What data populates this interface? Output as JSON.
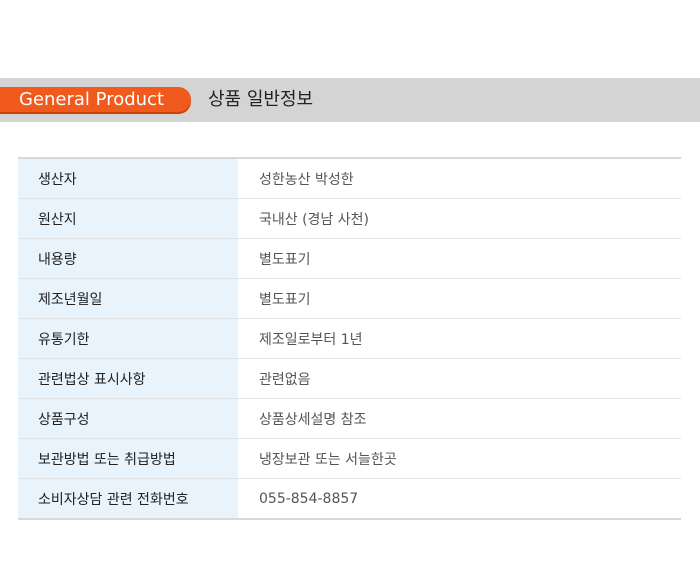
{
  "header": {
    "badge_label": "General Product",
    "title": "상품 일반정보",
    "accent_color": "#f05a1c",
    "bar_color": "#d4d4d4"
  },
  "table": {
    "label_bg_color": "#e8f3fc",
    "rows": [
      {
        "label": "생산자",
        "value": "성한농산 박성한"
      },
      {
        "label": "원산지",
        "value": "국내산 (경남 사천)"
      },
      {
        "label": "내용량",
        "value": "별도표기"
      },
      {
        "label": "제조년월일",
        "value": "별도표기"
      },
      {
        "label": "유통기한",
        "value": "제조일로부터 1년"
      },
      {
        "label": "관련법상 표시사항",
        "value": "관련없음"
      },
      {
        "label": "상품구성",
        "value": "상품상세설명 참조"
      },
      {
        "label": "보관방법 또는 취급방법",
        "value": "냉장보관 또는 서늘한곳"
      },
      {
        "label": "소비자상담 관련 전화번호",
        "value": "055-854-8857"
      }
    ]
  }
}
